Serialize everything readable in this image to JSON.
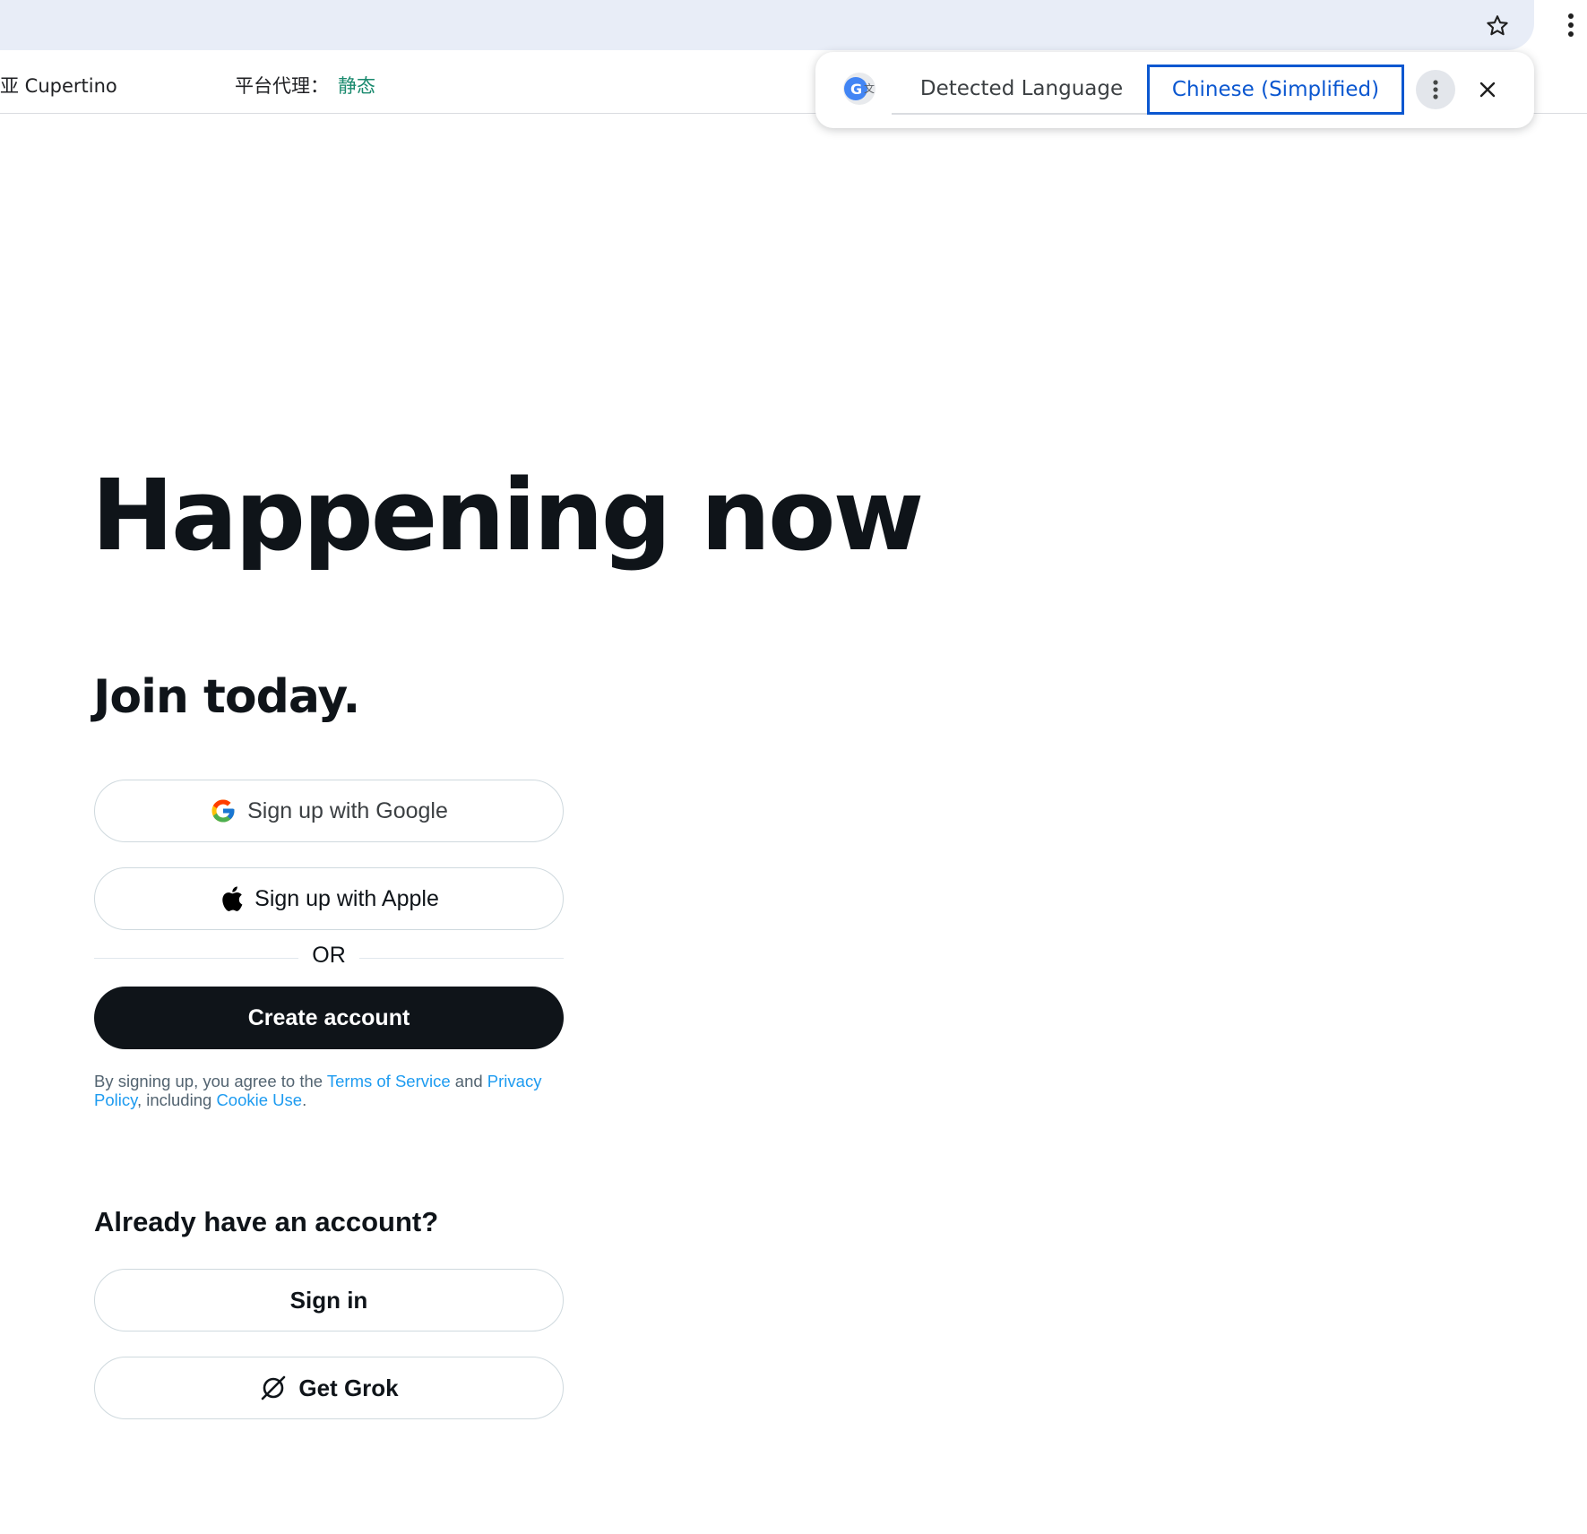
{
  "browser": {
    "bookmark_icon": "star-icon",
    "menu_icon": "kebab-menu-icon"
  },
  "extension_bar": {
    "location": "亚 Cupertino",
    "proxy_label": "平台代理：",
    "proxy_value": "静态"
  },
  "translate_popup": {
    "logo_icon": "google-translate-icon",
    "source_tab": "Detected Language",
    "target_tab": "Chinese (Simplified)",
    "more_icon": "more-vert-icon",
    "close_icon": "close-icon",
    "colors": {
      "accent": "#0b57d0"
    }
  },
  "page": {
    "headline": "Happening now",
    "subheadline": "Join today.",
    "google_button": "Sign up with Google",
    "apple_button": "Sign up with Apple",
    "divider_text": "OR",
    "create_button": "Create account",
    "legal": {
      "prefix": "By signing up, you agree to the ",
      "terms": "Terms of Service",
      "and": " and ",
      "privacy": "Privacy Policy",
      "including": ", including ",
      "cookie": "Cookie Use",
      "suffix": "."
    },
    "already_heading": "Already have an account?",
    "signin_button": "Sign in",
    "grok_button": "Get Grok",
    "colors": {
      "text": "#0f1419",
      "link": "#1d9bf0",
      "primary_button": "#0f1419"
    }
  }
}
